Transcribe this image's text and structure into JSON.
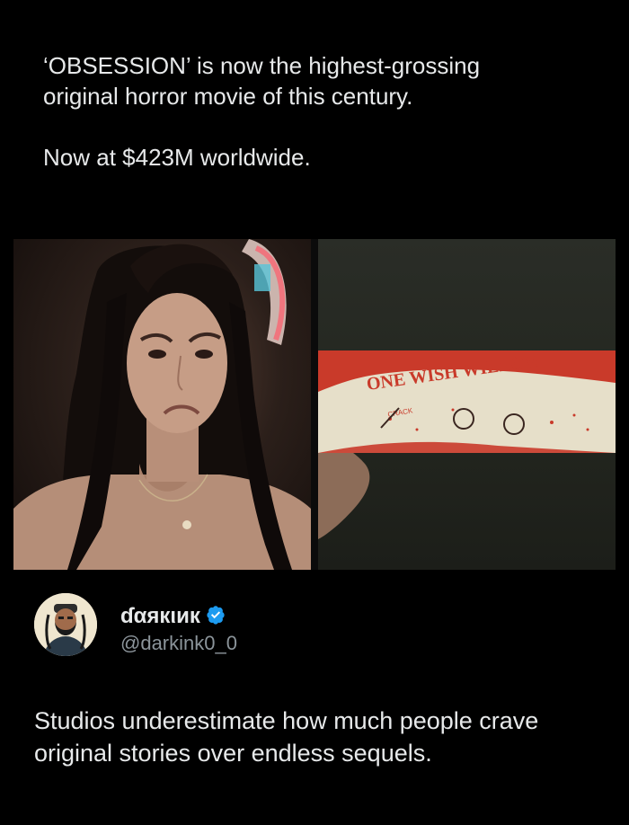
{
  "post": {
    "line1": "‘OBSESSION’ is now the highest-grossing",
    "line2": "original horror movie of this century.",
    "line3": "Now at $423M worldwide."
  },
  "media": {
    "right_still_text": "ONE WISH WILLOW",
    "right_still_subtext": "CRACK"
  },
  "account": {
    "display_name": "ɗαякιик",
    "handle": "@darkink0_0",
    "verified_color": "#1d9bf0"
  },
  "reply": {
    "text": "Studios underestimate how much people crave original stories over endless sequels."
  }
}
